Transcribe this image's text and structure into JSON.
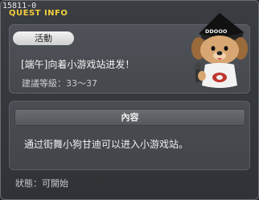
{
  "titlebar": {
    "quest_id": "15811-0",
    "label": "QUEST INFO"
  },
  "quest": {
    "category": "活動",
    "name": "[端午]向着小游戏站进发！",
    "level_label": "建議等級：",
    "level_range": "33～37"
  },
  "content": {
    "header": "內容",
    "description": "通过街舞小狗甘迪可以进入小游戏站。"
  },
  "status": {
    "label": "狀態：",
    "value": "可開始"
  },
  "npc": {
    "hat_text": "DDOOO"
  }
}
